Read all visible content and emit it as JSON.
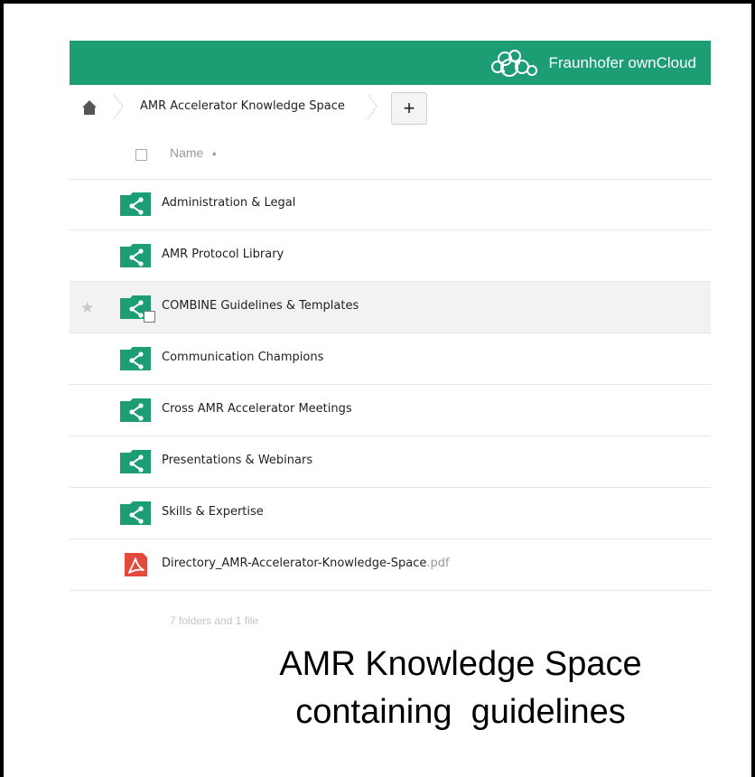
{
  "header": {
    "brand_name": "Fraunhofer ownCloud",
    "icon": "cloud-logo-icon",
    "color": "#1d9d74"
  },
  "breadcrumb": {
    "home_icon": "home-icon",
    "folder": "AMR Accelerator Knowledge Space",
    "new_button_label": "+"
  },
  "file_list": {
    "name_column_label": "Name",
    "sort_indicator": "▲",
    "items": [
      {
        "name": "Administration & Legal",
        "type": "shared-folder"
      },
      {
        "name": "AMR Protocol Library",
        "type": "shared-folder"
      },
      {
        "name": "COMBINE Guidelines & Templates",
        "type": "shared-folder"
      },
      {
        "name": "Communication Champions",
        "type": "shared-folder"
      },
      {
        "name": "Cross AMR Accelerator Meetings",
        "type": "shared-folder"
      },
      {
        "name": "Presentations & Webinars",
        "type": "shared-folder"
      },
      {
        "name": "Skills & Expertise",
        "type": "shared-folder"
      },
      {
        "name": "Directory_AMR-Accelerator-Knowledge-Space",
        "extension": ".pdf",
        "type": "pdf"
      }
    ],
    "summary": "7 folders and 1 file"
  },
  "caption": {
    "line1": "AMR Knowledge Space",
    "line2": "containing  guidelines"
  },
  "colors": {
    "folder_green": "#1d9d74",
    "pdf_red": "#e34a3c"
  }
}
